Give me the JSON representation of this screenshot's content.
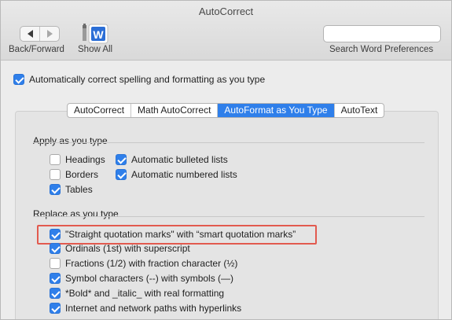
{
  "window": {
    "title": "AutoCorrect"
  },
  "toolbar": {
    "back_forward_label": "Back/Forward",
    "show_all_label": "Show All",
    "search_placeholder": "",
    "search_label": "Search Word Preferences"
  },
  "main": {
    "auto_correct_label": "Automatically correct spelling and formatting as you type",
    "auto_correct_checked": true
  },
  "tabs": [
    {
      "label": "AutoCorrect",
      "active": false
    },
    {
      "label": "Math AutoCorrect",
      "active": false
    },
    {
      "label": "AutoFormat as You Type",
      "active": true
    },
    {
      "label": "AutoText",
      "active": false
    }
  ],
  "apply_section": {
    "title": "Apply as you type",
    "col1": [
      {
        "label": "Headings",
        "checked": false
      },
      {
        "label": "Borders",
        "checked": false
      },
      {
        "label": "Tables",
        "checked": true
      }
    ],
    "col2": [
      {
        "label": "Automatic bulleted lists",
        "checked": true
      },
      {
        "label": "Automatic numbered lists",
        "checked": true
      }
    ]
  },
  "replace_section": {
    "title": "Replace as you type",
    "items": [
      {
        "label": "\"Straight quotation marks\" with “smart quotation marks”",
        "checked": true
      },
      {
        "label": "Ordinals (1st) with superscript",
        "checked": true
      },
      {
        "label": "Fractions (1/2) with fraction character (½)",
        "checked": false
      },
      {
        "label": "Symbol characters (--) with symbols (—)",
        "checked": true
      },
      {
        "label": "*Bold* and _italic_ with real formatting",
        "checked": true
      },
      {
        "label": "Internet and network paths with hyperlinks",
        "checked": true
      }
    ]
  },
  "colors": {
    "accent": "#2f7fea",
    "highlight": "#e25a4f"
  }
}
